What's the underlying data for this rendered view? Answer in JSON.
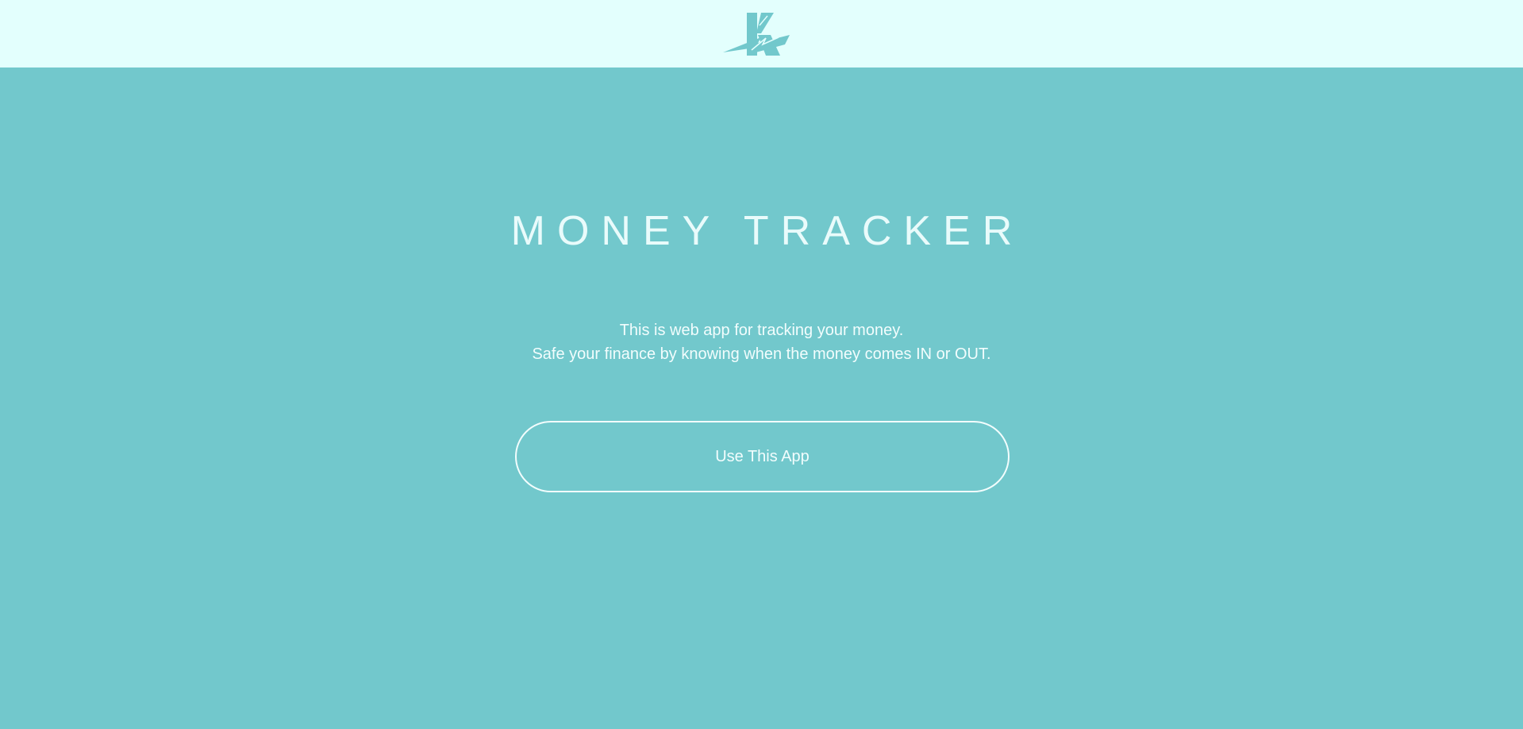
{
  "header": {
    "logo_icon": "lightning-k-logo",
    "background": "#e3fffd"
  },
  "hero": {
    "title": "MONEY TRACKER",
    "description_line1": "This is web app for tracking your money.",
    "description_line2": "Safe your finance by knowing when the money comes IN or OUT.",
    "cta_label": "Use This App",
    "background": "#72c8cc",
    "text_color": "#f2fdfd"
  }
}
